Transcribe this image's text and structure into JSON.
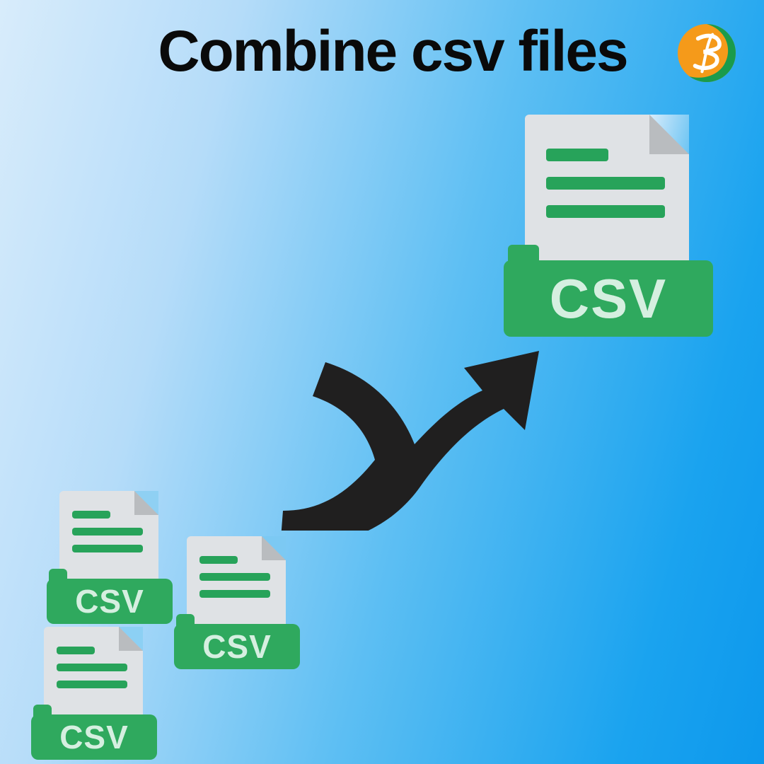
{
  "title": "Combine csv files",
  "csv_label": "CSV",
  "icons": {
    "logo": "logo-badge",
    "merge_arrow": "merge-arrow-icon",
    "csv_small_1": "csv-file-small-1",
    "csv_small_2": "csv-file-small-2",
    "csv_small_3": "csv-file-small-3",
    "csv_large": "csv-file-large"
  },
  "colors": {
    "green": "#2fa95e",
    "page": "#dfe2e5",
    "arrow": "#201f1f",
    "logo_orange": "#f59a1a",
    "logo_green": "#1a9b4c"
  }
}
